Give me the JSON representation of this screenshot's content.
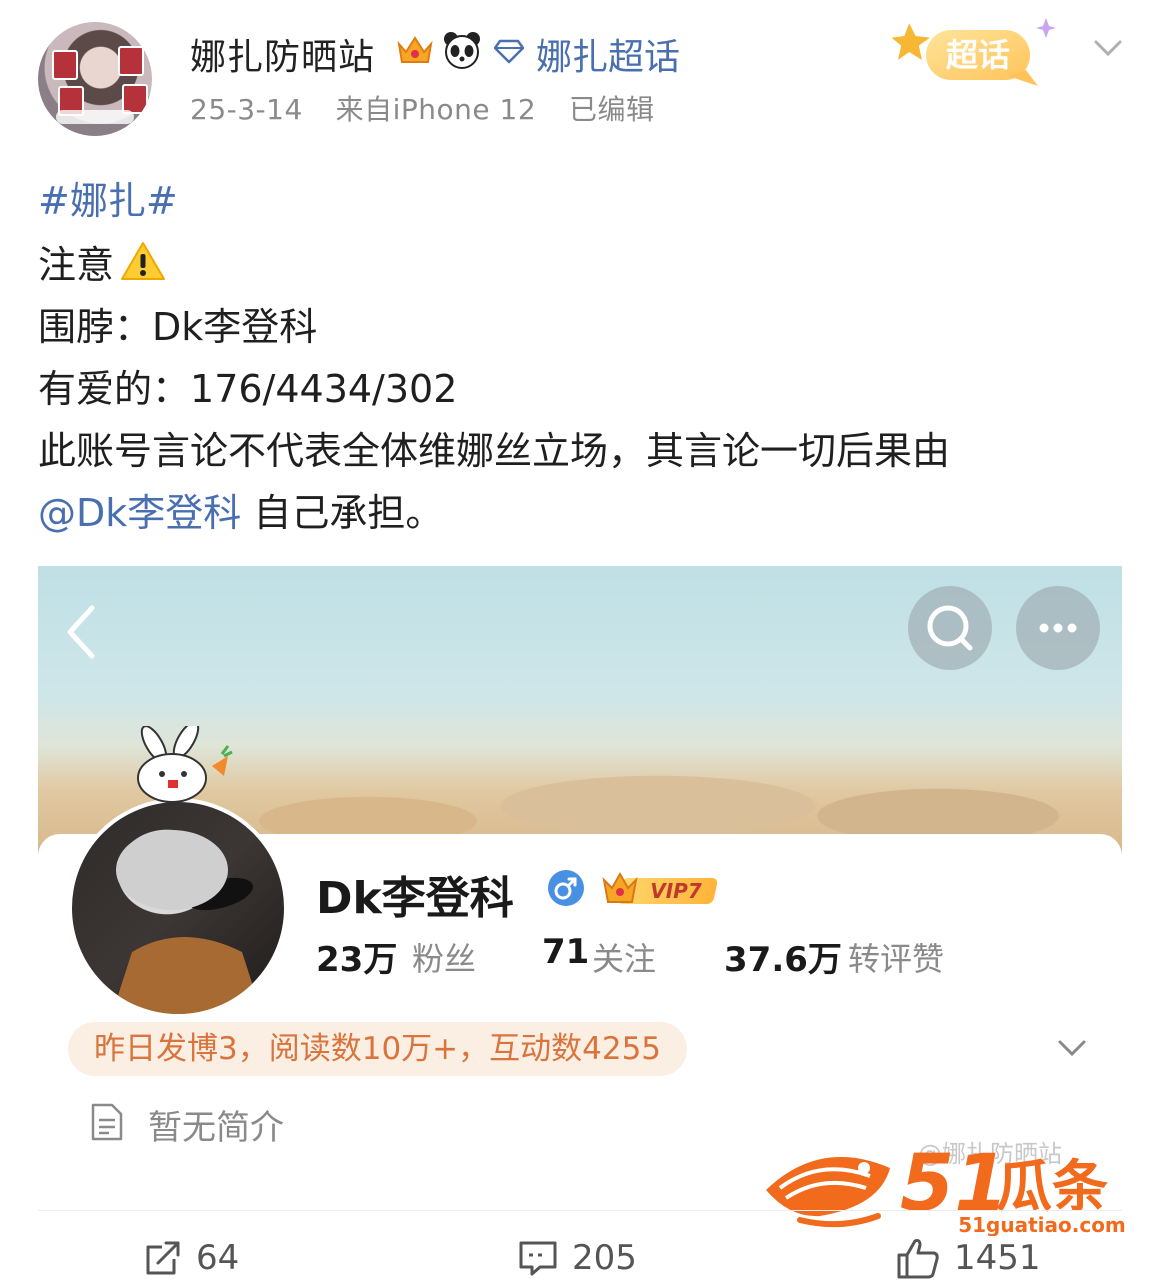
{
  "post": {
    "username": "娜扎防晒站",
    "supertopic_link": "娜扎超话",
    "date": "25-3-14",
    "source": "来自iPhone 12",
    "edited": "已编辑",
    "super_badge_label": "超话",
    "hashtag": "#娜扎#",
    "line_notice": "注意",
    "line_weibo_label": "围脖：",
    "line_weibo_value": "Dk李登科",
    "line_stats_label": "有爱的：",
    "line_stats_value": "176/4434/302",
    "line_disclaimer": "此账号言论不代表全体维娜丝立场，其言论一切后果由",
    "mention": "@Dk李登科",
    "line_end": "自己承担。"
  },
  "embedded_profile": {
    "name": "Dk李登科",
    "vip_label": "VIP7",
    "stats": [
      {
        "value": "23万",
        "label": "粉丝"
      },
      {
        "value": "71",
        "label": "关注"
      },
      {
        "value": "37.6万",
        "label": "转评赞"
      }
    ],
    "activity": "昨日发博3，阅读数10万+，互动数4255",
    "intro": "暂无简介",
    "watermark": "@娜扎防晒站"
  },
  "logo": {
    "brand": "51瓜条",
    "url": "51guatiao.com"
  },
  "actions": {
    "repost_count": "64",
    "comment_count": "205",
    "like_count": "1451"
  },
  "colors": {
    "link": "#4a6fb0",
    "activity_text": "#d9743c",
    "logo_orange": "#f26a1b"
  },
  "icons": [
    "crown-icon",
    "panda-icon",
    "diamond-icon",
    "chevron-down-icon",
    "warning-icon",
    "back-icon",
    "search-icon",
    "more-icon",
    "gender-male-icon",
    "vip-crown-icon",
    "document-icon",
    "repost-icon",
    "comment-icon",
    "like-icon"
  ]
}
